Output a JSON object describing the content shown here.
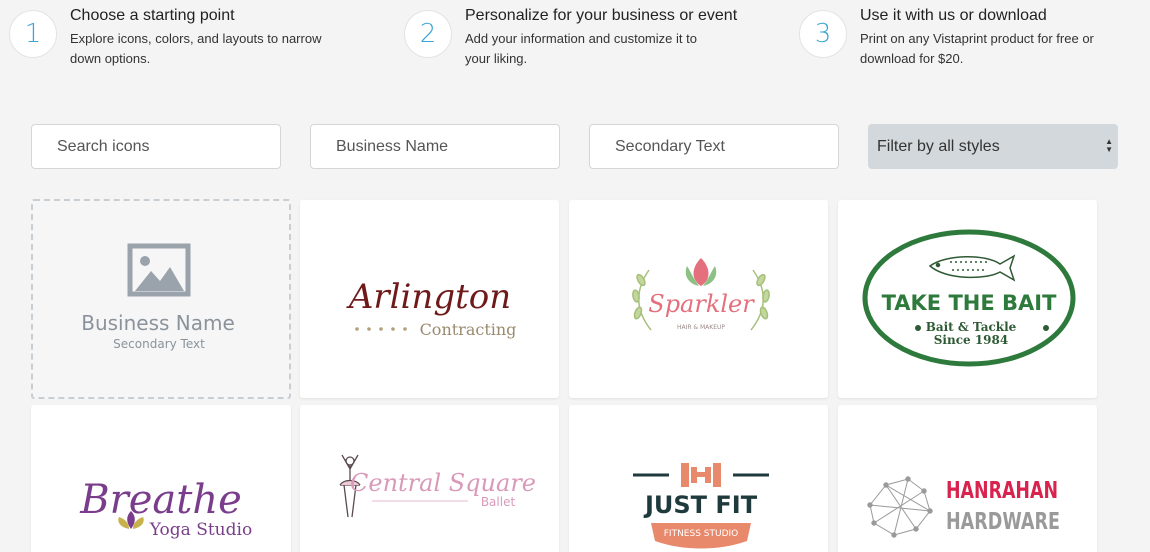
{
  "steps": [
    {
      "num": "1",
      "title": "Choose a starting point",
      "desc_line1": "Explore icons, colors, and layouts to narrow",
      "desc_line2": "down options."
    },
    {
      "num": "2",
      "title": "Personalize for your business or event",
      "desc_line1": "Add your information and customize it to",
      "desc_line2": "your liking."
    },
    {
      "num": "3",
      "title": "Use it with us or download",
      "desc_line1": "Print on any Vistaprint product for free or",
      "desc_line2": "download for $20."
    }
  ],
  "filters": {
    "search_placeholder": "Search icons",
    "business_placeholder": "Business Name",
    "secondary_placeholder": "Secondary Text",
    "style_selected": "Filter by all styles"
  },
  "cards": {
    "blank": {
      "name": "Business Name",
      "sub": "Secondary Text",
      "icon": "image-icon"
    },
    "arlington": {
      "name": "Arlington",
      "sub": "Contracting"
    },
    "sparkler": {
      "name": "Sparkler",
      "sub": "HAIR & MAKEUP"
    },
    "bait": {
      "name": "TAKE THE BAIT",
      "sub1": "Bait & Tackle",
      "sub2": "Since 1984"
    },
    "breathe": {
      "name": "Breathe",
      "sub": "Yoga Studio"
    },
    "central": {
      "name": "Central Square",
      "sub": "Ballet"
    },
    "justfit": {
      "name": "JUST FIT",
      "sub": "FITNESS STUDIO"
    },
    "hanrahan": {
      "name": "HANRAHAN",
      "sub": "HARDWARE"
    }
  },
  "colors": {
    "accent": "#3aa5d6",
    "select_bg": "#d3d8dc"
  }
}
